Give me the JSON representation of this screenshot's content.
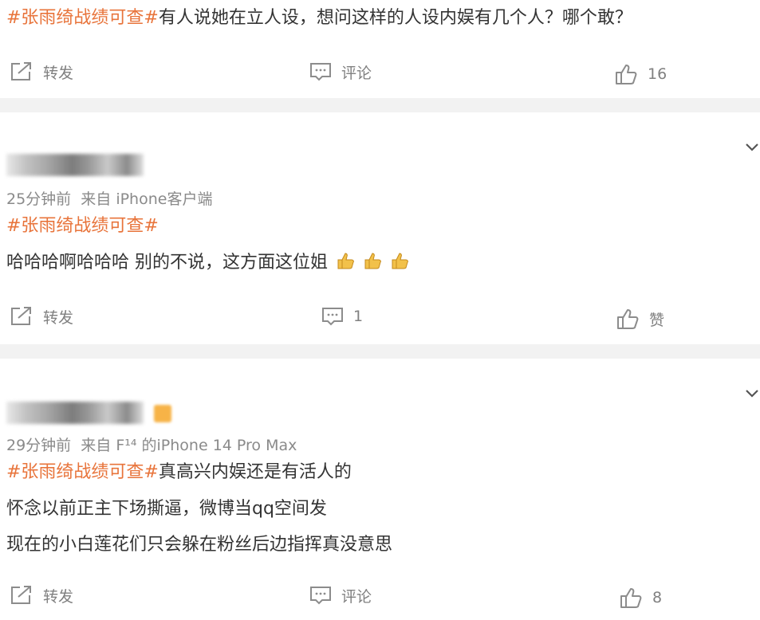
{
  "posts": [
    {
      "tag": "#张雨绮战绩可查#",
      "lines": [
        "有人说她在立人设，想问这样的人设内娱有几个人？哪个敢？"
      ],
      "actions": {
        "repost": "转发",
        "comment": "评论",
        "like": "16"
      }
    },
    {
      "time": "25分钟前",
      "source": "来自 iPhone客户端",
      "tag": "#张雨绮战绩可查#",
      "lines": [
        "哈哈哈啊哈哈哈 别的不说，这方面这位姐"
      ],
      "emojis": [
        "thumbs-up-emoji",
        "thumbs-up-emoji",
        "thumbs-up-emoji"
      ],
      "actions": {
        "repost": "转发",
        "comment": "1",
        "like": "赞"
      }
    },
    {
      "time": "29分钟前",
      "source": "来自 F¹⁴ 的iPhone 14 Pro Max",
      "tag": "#张雨绮战绩可查#",
      "lines": [
        "真高兴内娱还是有活人的",
        "怀念以前正主下场撕逼，微博当qq空间发",
        "现在的小白莲花们只会躲在粉丝后边指挥真没意思"
      ],
      "actions": {
        "repost": "转发",
        "comment": "评论",
        "like": "8"
      }
    }
  ],
  "icons": {
    "repost": "share-icon",
    "comment": "comment-icon",
    "like": "thumbs-up-icon",
    "menu": "chevron-down-icon"
  },
  "colors": {
    "tag": "#e8743b",
    "text": "#333333",
    "meta": "#8a8a8a",
    "divider": "#f2f2f2"
  }
}
